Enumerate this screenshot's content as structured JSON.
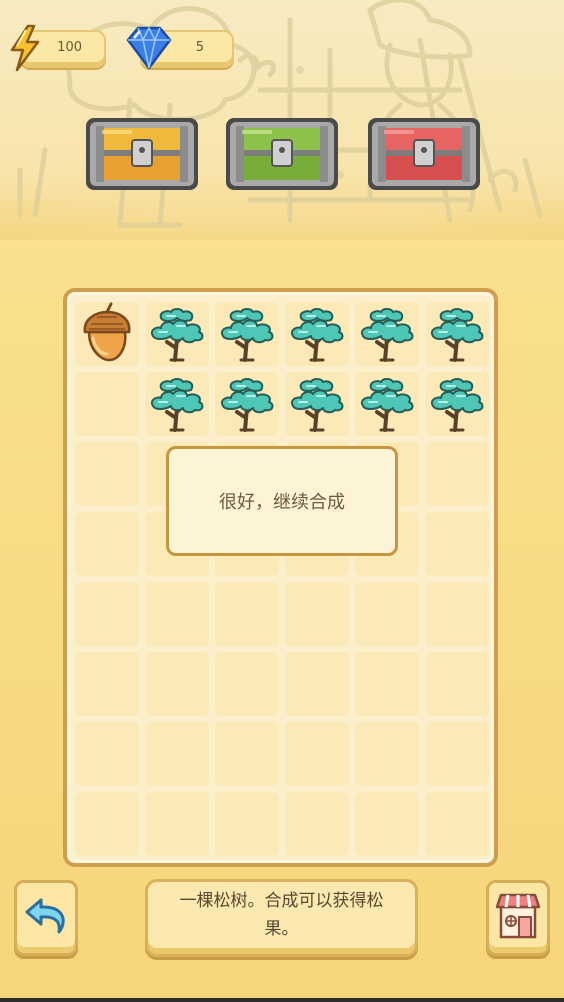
{
  "resources": {
    "energy": {
      "value": "100",
      "icon": "lightning-icon"
    },
    "gems": {
      "value": "5",
      "icon": "diamond-icon"
    }
  },
  "chests": [
    {
      "name": "chest-yellow",
      "color": "#f1b93c"
    },
    {
      "name": "chest-green",
      "color": "#8ec14a"
    },
    {
      "name": "chest-red",
      "color": "#e86463"
    }
  ],
  "board": {
    "columns": 6,
    "rows": 8,
    "items": [
      [
        "acorn",
        "pine-tree",
        "pine-tree",
        "pine-tree",
        "pine-tree",
        "pine-tree"
      ],
      [
        "",
        "pine-tree",
        "pine-tree",
        "pine-tree",
        "pine-tree",
        "pine-tree"
      ],
      [
        "",
        "",
        "",
        "",
        "",
        ""
      ],
      [
        "",
        "",
        "",
        "",
        "",
        ""
      ],
      [
        "",
        "",
        "",
        "",
        "",
        ""
      ],
      [
        "",
        "",
        "",
        "",
        "",
        ""
      ],
      [
        "",
        "",
        "",
        "",
        "",
        ""
      ],
      [
        "",
        "",
        "",
        "",
        "",
        ""
      ]
    ]
  },
  "toast": {
    "text": "很好，继续合成"
  },
  "footer": {
    "description": "一棵松树。合成可以获得松果。",
    "back_icon": "undo-arrow-icon",
    "shop_icon": "shop-icon"
  },
  "colors": {
    "board_border": "#cf9d4e",
    "cell": "#fbe9b8",
    "tree_foliage": "#4fc7b6"
  }
}
